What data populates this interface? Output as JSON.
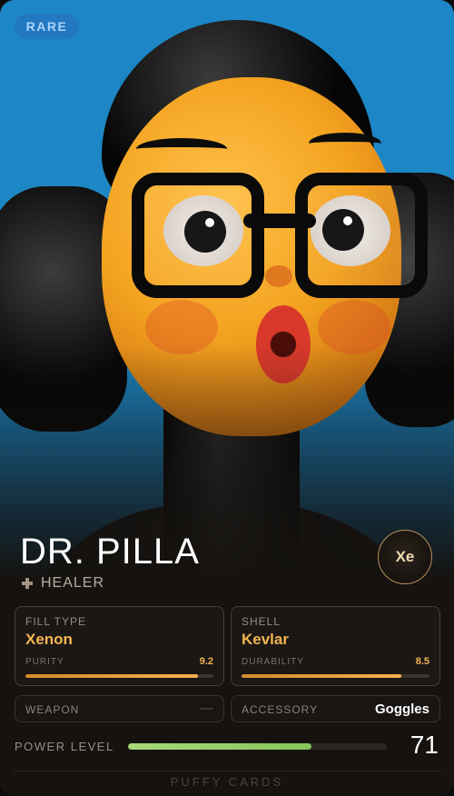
{
  "card": {
    "rarity": "RARE",
    "name": "DR. PILLA",
    "class": "HEALER",
    "class_icon": "cross-icon",
    "element_badge": "Xe",
    "footer": "PUFFY CARDS"
  },
  "stats": {
    "fill": {
      "label": "FILL TYPE",
      "value": "Xenon",
      "sub_label": "PURITY",
      "sub_value": "9.2",
      "level": 0.92
    },
    "shell": {
      "label": "SHELL",
      "value": "Kevlar",
      "sub_label": "DURABILITY",
      "sub_value": "8.5",
      "level": 0.85
    }
  },
  "slots": {
    "weapon": {
      "label": "WEAPON",
      "value": "—"
    },
    "accessory": {
      "label": "ACCESSORY",
      "value": "Goggles"
    }
  },
  "power": {
    "label": "POWER LEVEL",
    "value": "71",
    "level": 0.71
  },
  "colors": {
    "accent": "#f4b552",
    "power_bar": "#a8d97a",
    "rarity_badge": "#a9d4ff",
    "background": "#15120f"
  }
}
